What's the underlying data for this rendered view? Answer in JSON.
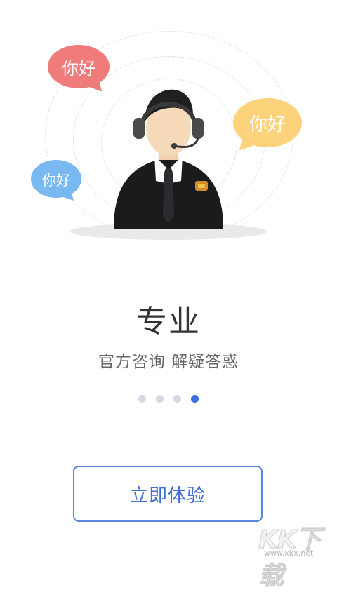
{
  "illustration": {
    "bubbles": [
      {
        "text": "你好",
        "color": "#f07b7b"
      },
      {
        "text": "你好",
        "color": "#fcd37b"
      },
      {
        "text": "你好",
        "color": "#7ab8f2"
      }
    ],
    "agent_icon": "customer-service-agent-with-headset"
  },
  "intro": {
    "title": "专业",
    "subtitle": "官方咨询 解疑答惑"
  },
  "pager": {
    "total": 4,
    "active_index": 4,
    "active_color": "#3d6fdb",
    "inactive_color": "#d3dae6"
  },
  "cta": {
    "label": "立即体验",
    "color": "#3f6fd5"
  },
  "watermark": {
    "logo": "KK下载",
    "url": "www.kkx.net"
  }
}
